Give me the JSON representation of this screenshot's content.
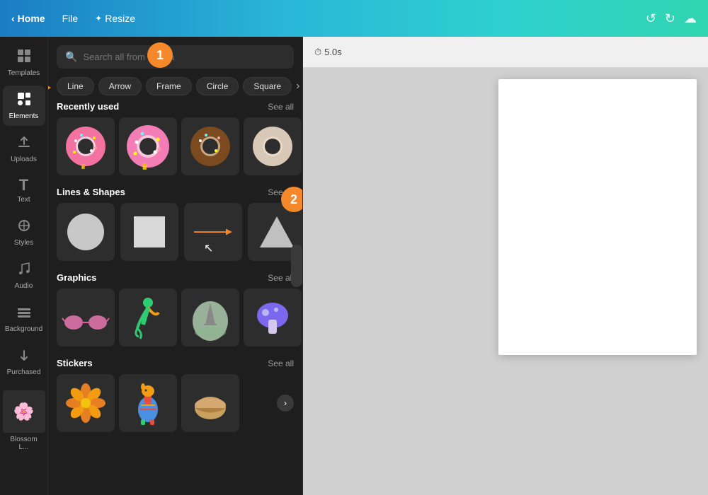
{
  "topbar": {
    "home_label": "Home",
    "file_label": "File",
    "resize_label": "Resize",
    "undo_symbol": "↺",
    "redo_symbol": "↻",
    "cloud_symbol": "☁"
  },
  "sidebar": {
    "items": [
      {
        "id": "templates",
        "icon": "⊞",
        "label": "Templates"
      },
      {
        "id": "elements",
        "icon": "✦",
        "label": "Elements",
        "active": true
      },
      {
        "id": "uploads",
        "icon": "⬆",
        "label": "Uploads"
      },
      {
        "id": "text",
        "icon": "T",
        "label": "Text"
      },
      {
        "id": "styles",
        "icon": "◈",
        "label": "Styles"
      },
      {
        "id": "audio",
        "icon": "♪",
        "label": "Audio"
      },
      {
        "id": "background",
        "icon": "▦",
        "label": "Background"
      },
      {
        "id": "purchased",
        "icon": "⬇",
        "label": "Purchased"
      },
      {
        "id": "blossom",
        "icon": "🌸",
        "label": "Blossom L..."
      }
    ]
  },
  "panel": {
    "search_placeholder": "Search all from Canva",
    "chips": [
      "Line",
      "Arrow",
      "Frame",
      "Circle",
      "Square"
    ],
    "sections": {
      "recently_used": {
        "title": "Recently used",
        "see_all": "See all"
      },
      "lines_shapes": {
        "title": "Lines & Shapes",
        "see_all": "See all"
      },
      "graphics": {
        "title": "Graphics",
        "see_all": "See all"
      },
      "stickers": {
        "title": "Stickers",
        "see_all": "See all"
      }
    }
  },
  "canvas": {
    "timer": "5.0s"
  },
  "annotations": {
    "badge1": "1",
    "badge2": "2"
  }
}
